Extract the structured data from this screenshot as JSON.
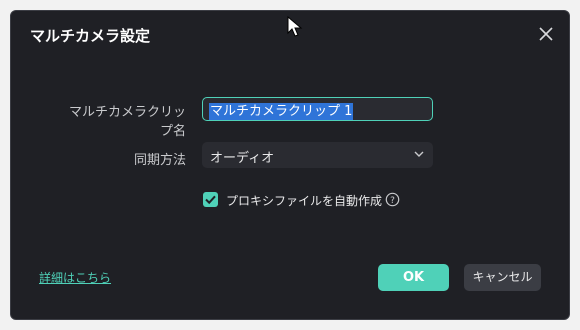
{
  "dialog": {
    "title": "マルチカメラ設定",
    "close_icon": "close-icon"
  },
  "form": {
    "clip_name_label": "マルチカメラクリップ名",
    "clip_name_value": "マルチカメラクリップ 1",
    "sync_method_label": "同期方法",
    "sync_method_value": "オーディオ",
    "proxy_label": "プロキシファイルを自動作成",
    "proxy_checked": true
  },
  "footer": {
    "details_link": "詳細はこちら",
    "ok_label": "OK",
    "cancel_label": "キャンセル"
  },
  "colors": {
    "accent": "#4fd1b8",
    "dialog_bg": "#1f2025",
    "selection": "#2f74d8"
  }
}
